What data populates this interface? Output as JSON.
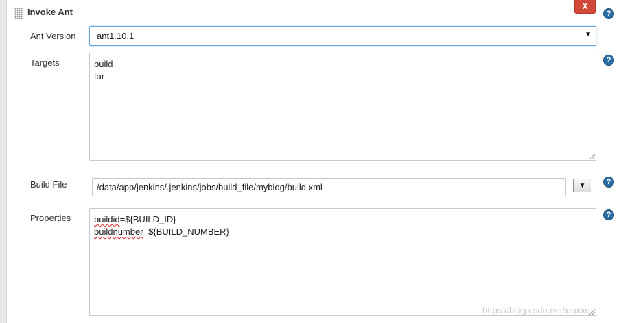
{
  "section": {
    "title": "Invoke Ant",
    "close_label": "X",
    "help_glyph": "?"
  },
  "ant_version": {
    "label": "Ant Version",
    "value": "ant1.10.1",
    "arrow": "▼"
  },
  "targets": {
    "label": "Targets",
    "lines": [
      "build",
      "tar"
    ]
  },
  "build_file": {
    "label": "Build File",
    "value": "/data/app/jenkins/.jenkins/jobs/build_file/myblog/build.xml",
    "arrow": "▼"
  },
  "properties": {
    "label": "Properties",
    "line1_key": "buildid",
    "line1_rest": "=${BUILD_ID}",
    "line2_key": "buildnumber",
    "line2_rest": "=${BUILD_NUMBER}"
  },
  "watermark": "https://blog.csdn.net/xiaxxq",
  "colors": {
    "close_button": "#d24939",
    "help_icon": "#2b6ea6",
    "focus_border": "#6aa2da",
    "spellcheck_underline": "#dd2222"
  }
}
